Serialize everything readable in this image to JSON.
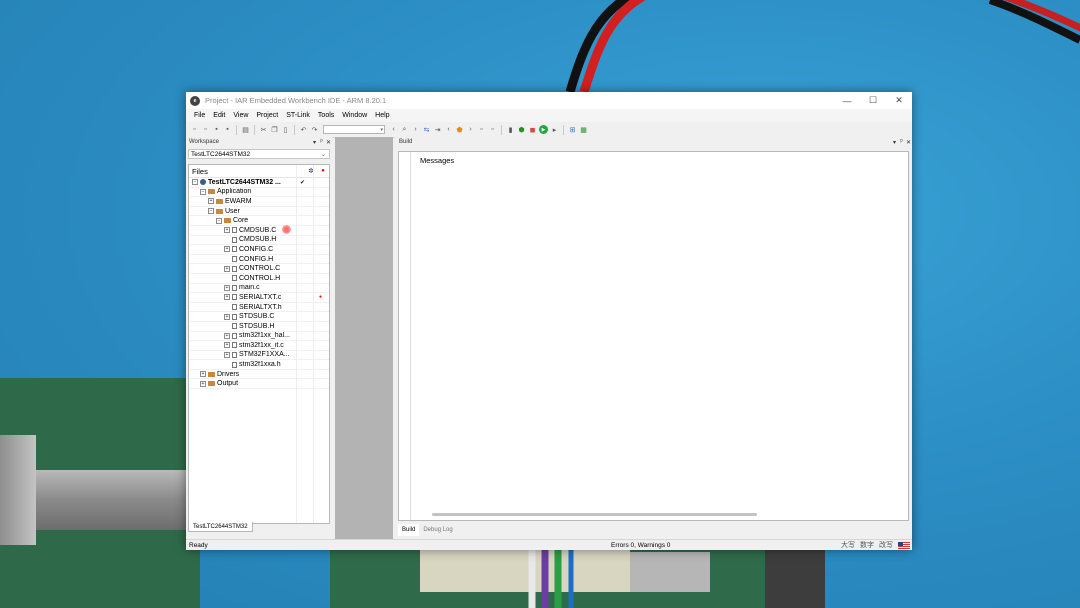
{
  "window": {
    "title": "Project - IAR Embedded Workbench IDE - ARM 8.20.1",
    "icon_letter": "e",
    "controls": [
      "—",
      "☐",
      "✕"
    ]
  },
  "menu": [
    "File",
    "Edit",
    "View",
    "Project",
    "ST-Link",
    "Tools",
    "Window",
    "Help"
  ],
  "workspace": {
    "title": "Workspace",
    "combo_value": "TestLTC2644STM32",
    "files_header": "Files",
    "bottom_tab": "TestLTC2644STM32",
    "tree": [
      {
        "label": "TestLTC2644STM32 ...",
        "type": "project",
        "toggle": "⊟",
        "check": "✔",
        "depth": 0
      },
      {
        "label": "Application",
        "type": "folder",
        "toggle": "⊟",
        "depth": 1
      },
      {
        "label": "EWARM",
        "type": "folder",
        "toggle": "⊞",
        "depth": 2
      },
      {
        "label": "User",
        "type": "folder",
        "toggle": "⊟",
        "depth": 2
      },
      {
        "label": "Core",
        "type": "folder",
        "toggle": "⊟",
        "depth": 3
      },
      {
        "label": "CMDSUB.C",
        "type": "file",
        "toggle": "⊞",
        "depth": 4
      },
      {
        "label": "CMDSUB.H",
        "type": "file",
        "toggle": "",
        "depth": 4
      },
      {
        "label": "CONFIG.C",
        "type": "file",
        "toggle": "⊞",
        "depth": 4
      },
      {
        "label": "CONFIG.H",
        "type": "file",
        "toggle": "",
        "depth": 4
      },
      {
        "label": "CONTROL.C",
        "type": "file",
        "toggle": "⊞",
        "depth": 4
      },
      {
        "label": "CONTROL.H",
        "type": "file",
        "toggle": "",
        "depth": 4
      },
      {
        "label": "main.c",
        "type": "file",
        "toggle": "⊞",
        "depth": 4
      },
      {
        "label": "SERIALTXT.c",
        "type": "file",
        "toggle": "⊞",
        "depth": 4,
        "dot": true
      },
      {
        "label": "SERIALTXT.h",
        "type": "file",
        "toggle": "",
        "depth": 4
      },
      {
        "label": "STDSUB.C",
        "type": "file",
        "toggle": "⊞",
        "depth": 4
      },
      {
        "label": "STDSUB.H",
        "type": "file",
        "toggle": "",
        "depth": 4
      },
      {
        "label": "stm32f1xx_hal...",
        "type": "file",
        "toggle": "⊞",
        "depth": 4
      },
      {
        "label": "stm32f1xx_it.c",
        "type": "file",
        "toggle": "⊞",
        "depth": 4
      },
      {
        "label": "STM32F1XXA...",
        "type": "file",
        "toggle": "⊞",
        "depth": 4
      },
      {
        "label": "stm32f1xxa.h",
        "type": "file",
        "toggle": "",
        "depth": 4
      },
      {
        "label": "Drivers",
        "type": "folder",
        "toggle": "⊞",
        "depth": 1
      },
      {
        "label": "Output",
        "type": "folder",
        "toggle": "⊞",
        "depth": 1
      }
    ]
  },
  "build": {
    "title": "Build",
    "messages_header": "Messages",
    "tabs": [
      "Build",
      "Debug Log"
    ]
  },
  "status": {
    "ready": "Ready",
    "errors": "Errors 0, Warnings 0",
    "ime": [
      "大写",
      "数字",
      "改写"
    ]
  },
  "pane_buttons": [
    "▾",
    "ᵖ",
    "✕"
  ]
}
